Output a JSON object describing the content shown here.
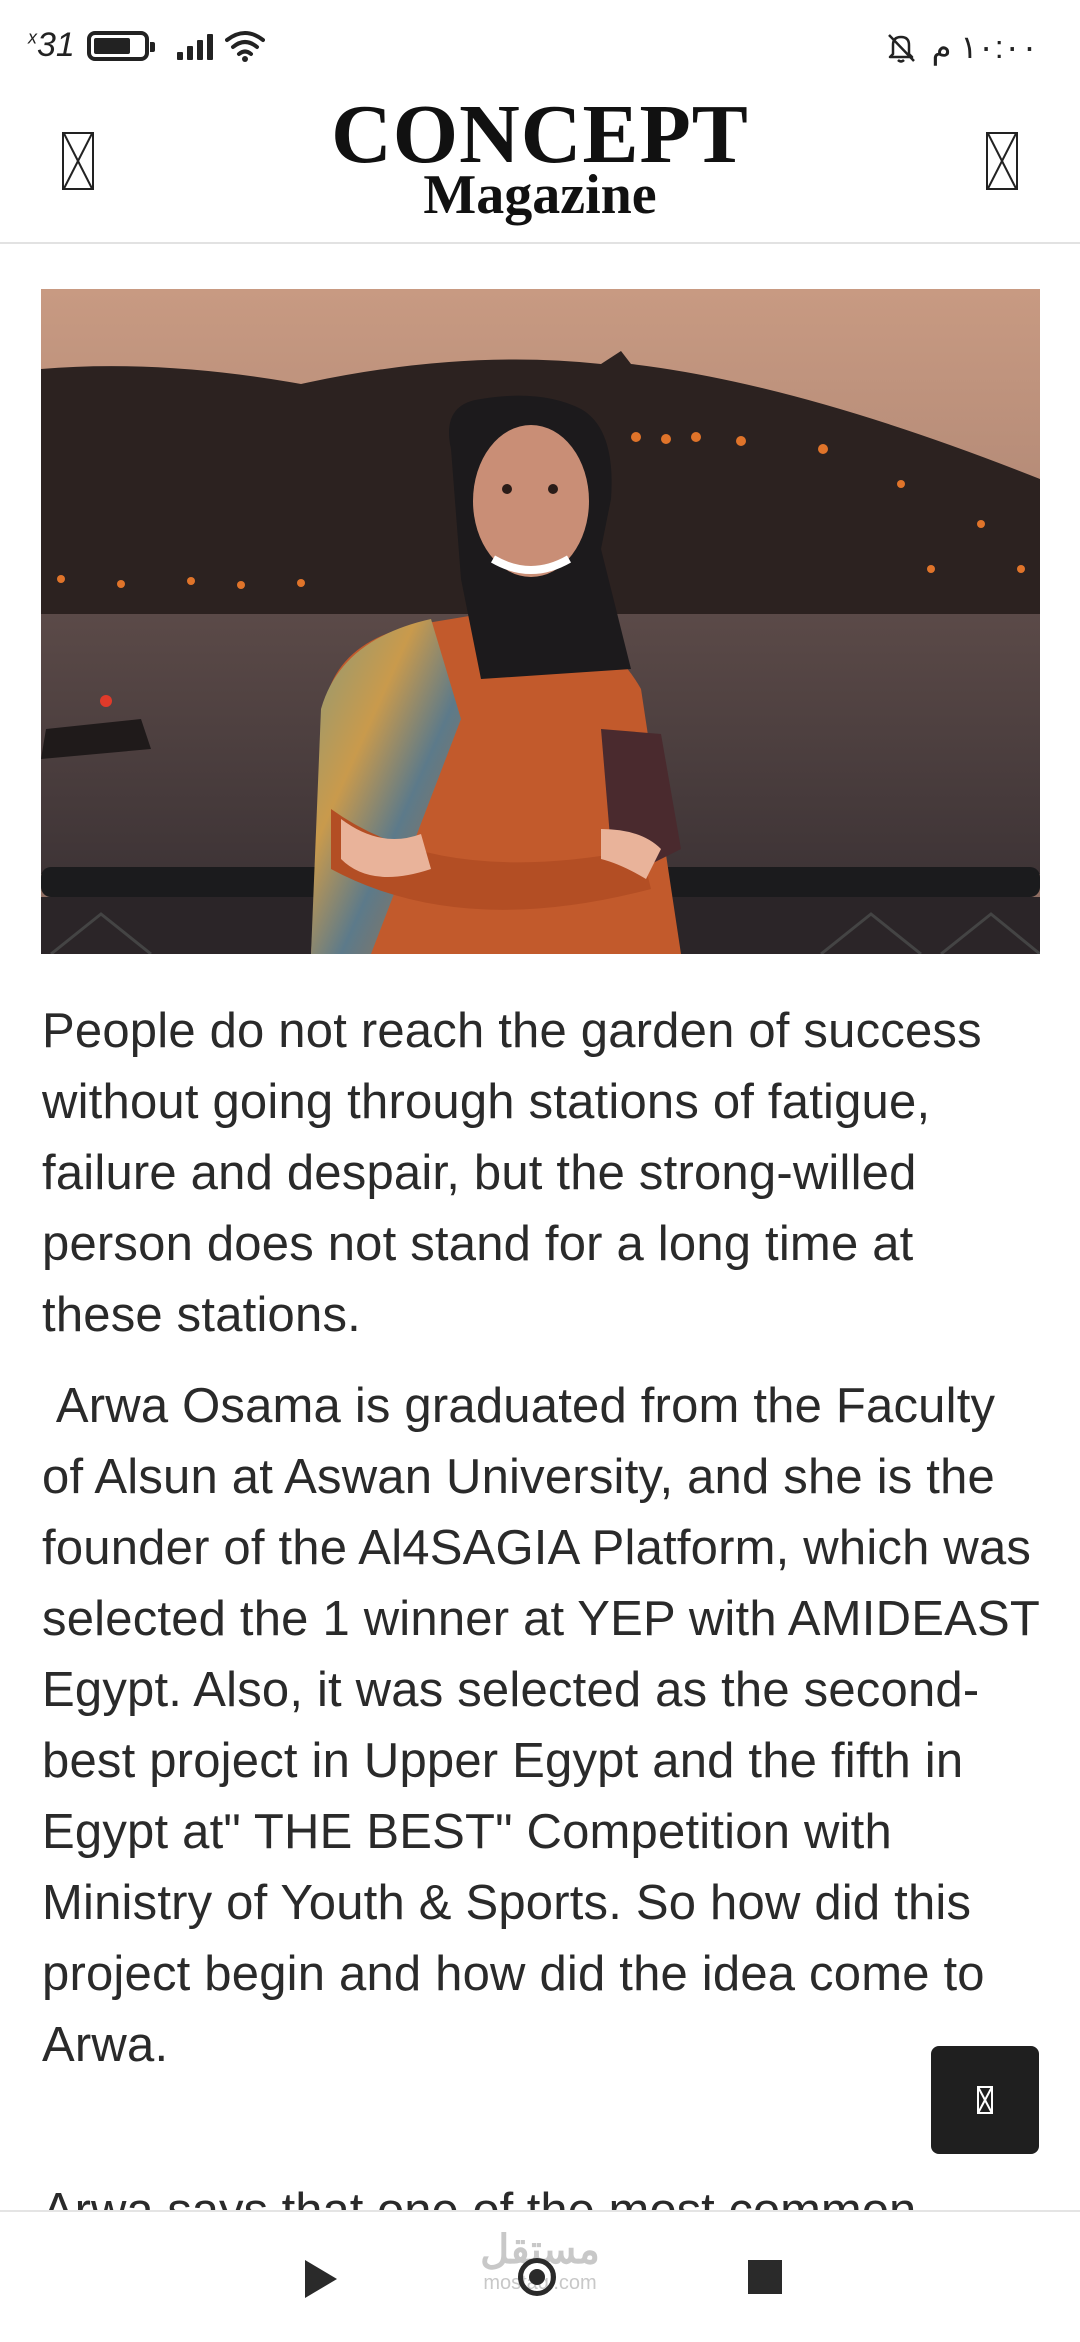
{
  "status_bar": {
    "battery_mark": "x",
    "battery_percent": "31",
    "time": "١٠:٠٠ م"
  },
  "header": {
    "logo_line1": "CONCEPT",
    "logo_line2": "Magazine",
    "left_icon": "missing-glyph-icon",
    "right_icon": "missing-glyph-icon"
  },
  "article": {
    "paragraphs": [
      "People do not reach the garden of success without going through stations of fatigue, failure and despair, but the strong-willed person does not stand for a long time at these stations.",
      " Arwa Osama is graduated from the Faculty of Alsun at Aswan University, and she is the founder of the Al4SAGIA Platform, which was selected the 1 winner at YEP with AMIDEAST Egypt. Also, it was selected as the second-best project in Upper Egypt and the fifth in Egypt at\" THE BEST\" Competition with Ministry of Youth & Sports. So how did this project begin and how did the idea come to Arwa."
    ],
    "next_paragraph_peek": "Arwa says that one of the most common"
  },
  "floating_button": {
    "icon": "missing-glyph-icon"
  },
  "watermark": {
    "arabic": "مستقل",
    "latin": "mostaql.com"
  },
  "colors": {
    "background": "#ffffff",
    "text": "#2a2a2a",
    "fab": "#1f1f1f"
  }
}
